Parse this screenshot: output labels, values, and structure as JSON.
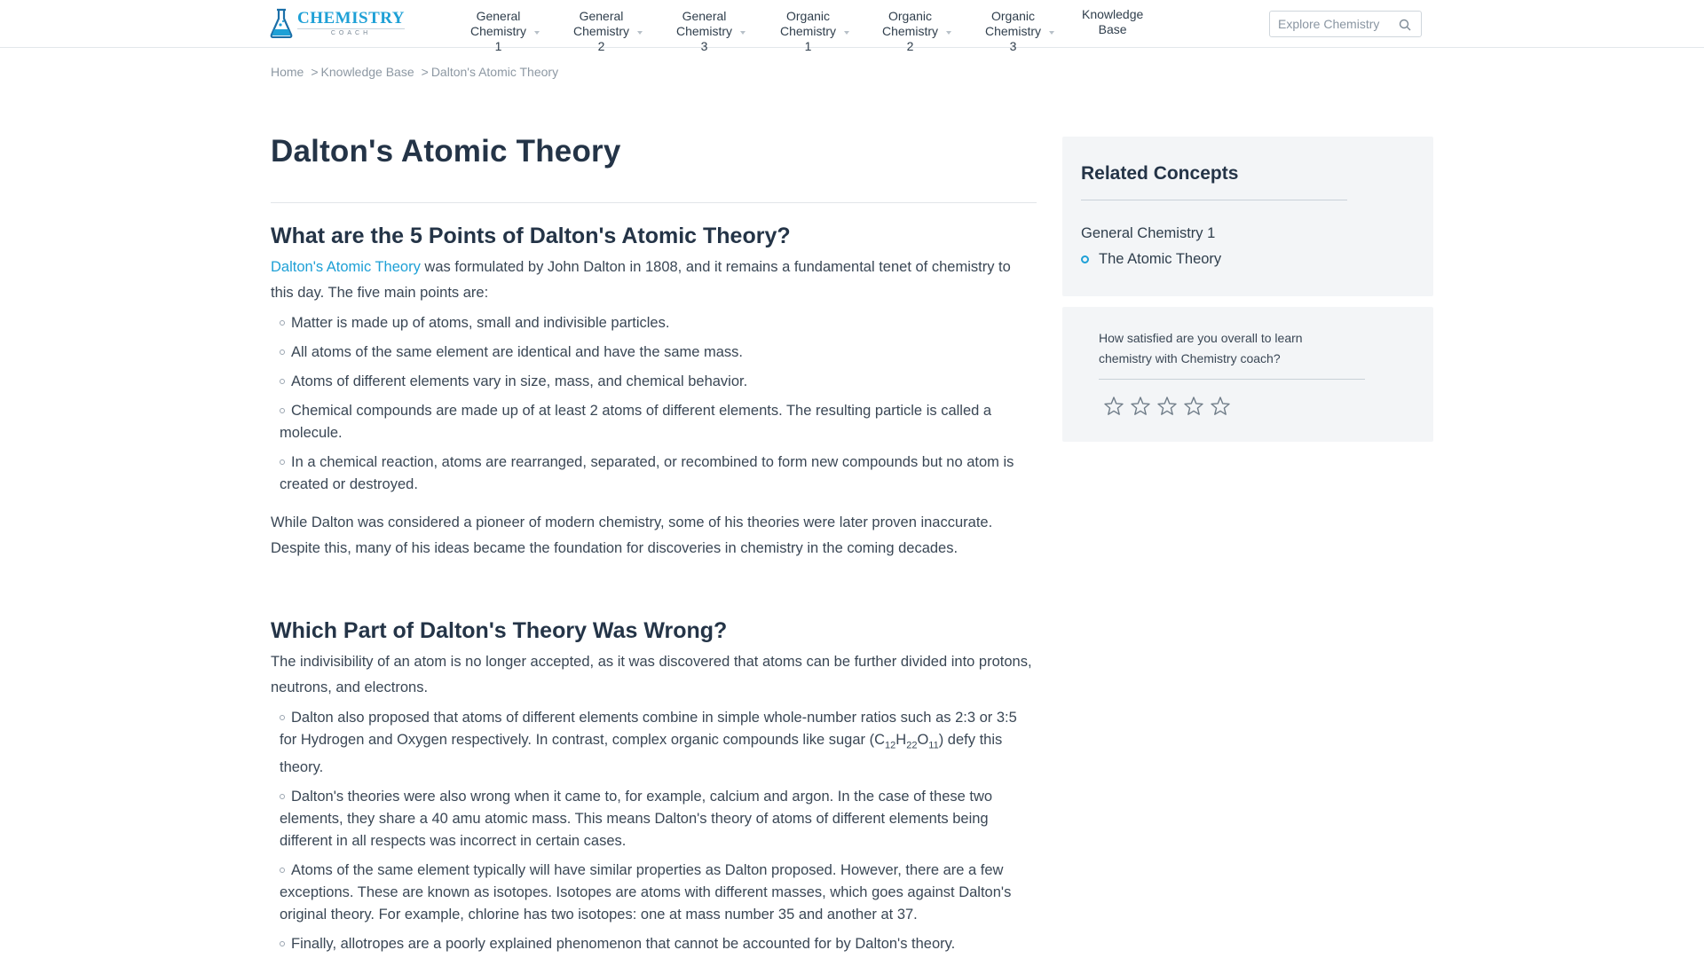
{
  "logo": {
    "main": "CHEMISTRY",
    "sub": "COACH"
  },
  "nav": {
    "items": [
      {
        "line1": "General",
        "line2": "Chemistry 1"
      },
      {
        "line1": "General",
        "line2": "Chemistry 2"
      },
      {
        "line1": "General",
        "line2": "Chemistry 3"
      },
      {
        "line1": "Organic",
        "line2": "Chemistry 1"
      },
      {
        "line1": "Organic",
        "line2": "Chemistry 2"
      },
      {
        "line1": "Organic",
        "line2": "Chemistry 3"
      },
      {
        "line1": "Knowledge",
        "line2": "Base"
      }
    ]
  },
  "search": {
    "placeholder": "Explore Chemistry"
  },
  "breadcrumb": {
    "home": "Home",
    "sep1": ">",
    "kb": "Knowledge Base",
    "sep2": ">",
    "current": "Dalton's Atomic Theory"
  },
  "article": {
    "title": "Dalton's Atomic Theory",
    "section1": {
      "heading": "What are the 5 Points of Dalton's Atomic Theory?",
      "intro_link": "Dalton's Atomic Theory",
      "intro_rest": " was formulated by John Dalton in 1808, and it remains a fundamental tenet of chemistry to this day. The five main points are:",
      "points": [
        "Matter is made up of atoms, small and indivisible particles.",
        "All atoms of the same element are identical and have the same mass.",
        "Atoms of different elements vary in size, mass, and chemical behavior.",
        "Chemical compounds are made up of at least 2 atoms of different elements. The resulting particle is called a molecule.",
        "In a chemical reaction, atoms are rearranged, separated, or recombined to form new compounds but no atom is created or destroyed."
      ],
      "outro": "While Dalton was considered a pioneer of modern chemistry, some of his theories were later proven inaccurate. Despite this, many of his ideas became the foundation for discoveries in chemistry in the coming decades."
    },
    "section2": {
      "heading": "Which Part of Dalton's Theory Was Wrong?",
      "intro": "The indivisibility of an atom is no longer accepted, as it was discovered that atoms can be further divided into protons, neutrons, and electrons.",
      "p1_before": "Dalton also proposed that atoms of different elements combine in simple whole-number ratios such as 2:3 or 3:5 for Hydrogen and Oxygen respectively. In contrast, complex organic compounds like sugar (C",
      "p1_sub1": "12",
      "p1_h": "H",
      "p1_sub2": "22",
      "p1_o": "O",
      "p1_sub3": "11",
      "p1_after": ") defy this theory.",
      "p2": "Dalton's theories were also wrong when it came to, for example, calcium and argon. In the case of these two elements, they share a 40 amu atomic mass. This means Dalton's theory of atoms of different elements being different in all respects was incorrect in certain cases.",
      "p3": "Atoms of the same element typically will have similar properties as Dalton proposed. However, there are a few exceptions. These are known as isotopes. Isotopes are atoms with different masses, which goes against Dalton's original theory. For example, chlorine has two isotopes: one at mass number 35 and another at 37.",
      "p4": "Finally, allotropes are a poorly explained phenomenon that cannot be accounted for by Dalton's theory."
    }
  },
  "sidebar": {
    "related_title": "Related Concepts",
    "category": "General Chemistry 1",
    "link": "The Atomic Theory",
    "survey_question": "How satisfied are you overall to learn chemistry with Chemistry coach?",
    "rating": 0,
    "rating_max": 5
  },
  "colors": {
    "accent": "#1ea0d6",
    "heading": "#243447",
    "panel": "#f3f5f7"
  }
}
